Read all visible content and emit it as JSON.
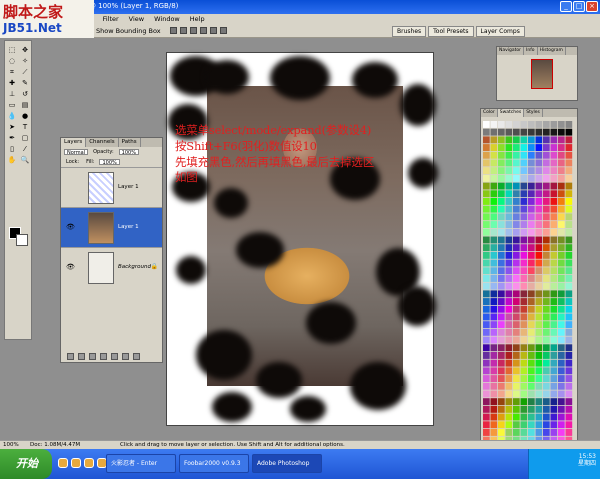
{
  "window": {
    "title": "13].jpg @ 100% (Layer 1, RGB/8)",
    "controls": [
      "_",
      "□",
      "×"
    ]
  },
  "watermark": {
    "site_name_cn": "脚本之家",
    "site_domain": "JB51.Net"
  },
  "menu": {
    "items": [
      "t",
      "Filter",
      "View",
      "Window",
      "Help"
    ]
  },
  "options_bar": {
    "show_bounding_box": "Show Bounding Box",
    "palette_well_tabs": [
      "Brushes",
      "Tool Presets",
      "Layer Comps"
    ]
  },
  "layers_panel": {
    "tabs": [
      "Layers",
      "Channels",
      "Paths"
    ],
    "blend_mode": "Normal",
    "opacity_label": "Opacity:",
    "opacity_value": "100%",
    "lock_label": "Lock:",
    "fill_label": "Fill:",
    "fill_value": "100%",
    "layers": [
      {
        "name": "Layer 1",
        "visible": false,
        "selected": false
      },
      {
        "name": "Layer 1",
        "visible": true,
        "selected": true
      },
      {
        "name": "Background",
        "visible": true,
        "selected": false,
        "locked": true
      }
    ]
  },
  "navigator_panel": {
    "tabs": [
      "Navigator",
      "Info",
      "Histogram"
    ]
  },
  "swatches_panel": {
    "tabs": [
      "Color",
      "Swatches",
      "Styles"
    ]
  },
  "overlay_instructions": [
    "选菜单select/mode/expand(参数设4)",
    "按Shift+F6(羽化)数值设10",
    "先填充黑色,然后再填黑色,最后去掉选区",
    "如图"
  ],
  "status_bar": {
    "zoom": "100%",
    "doc_size": "Doc: 1.08M/4.47M",
    "hint": "Click and drag to move layer or selection. Use Shift and Alt for additional options."
  },
  "taskbar": {
    "start_label": "开始",
    "tasks": [
      "火影忍者 - Enter",
      "Foobar2000 v0.9.3",
      "Adobe Photoshop"
    ],
    "active_task_index": 2,
    "clock_time": "15:53",
    "clock_day": "星期四"
  }
}
